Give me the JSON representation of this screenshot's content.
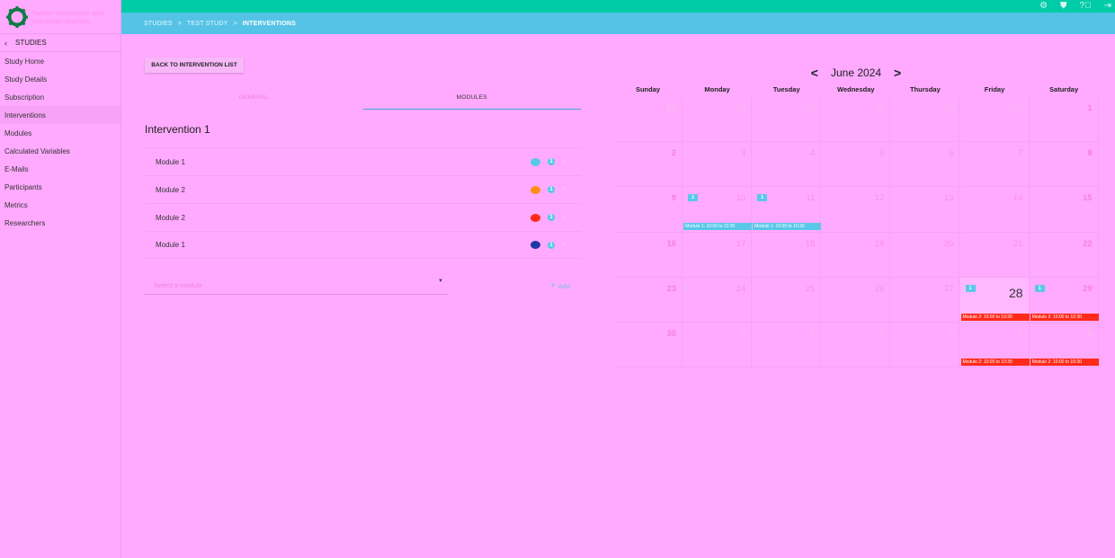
{
  "app": {
    "name": "Twente Intervention and Interaction Machine"
  },
  "sidebar": {
    "back_label": "STUDIES",
    "items": [
      {
        "label": "Study Home"
      },
      {
        "label": "Study Details"
      },
      {
        "label": "Subscription"
      },
      {
        "label": "Interventions",
        "active": true
      },
      {
        "label": "Modules"
      },
      {
        "label": "Calculated Variables"
      },
      {
        "label": "E-Mails"
      },
      {
        "label": "Participants"
      },
      {
        "label": "Metrics"
      },
      {
        "label": "Researchers"
      }
    ]
  },
  "topbar": {
    "icons": [
      "settings-icon",
      "shield-icon",
      "help-icon",
      "logout-icon"
    ]
  },
  "breadcrumb": [
    "STUDIES",
    "TEST STUDY",
    "INTERVENTIONS"
  ],
  "main": {
    "back_button": "BACK TO INTERVENTION LIST",
    "tabs": [
      {
        "label": "GENERAL"
      },
      {
        "label": "MODULES",
        "active": true
      }
    ],
    "intervention_title": "Intervention 1",
    "modules": [
      {
        "name": "Module 1",
        "color": "#58c8e8",
        "badge": "1"
      },
      {
        "name": "Module 2",
        "color": "#ff8c1a",
        "badge": "1"
      },
      {
        "name": "Module 2",
        "color": "#ff2a1a",
        "badge": "1"
      },
      {
        "name": "Module 1",
        "color": "#1f3aa8",
        "badge": "1"
      }
    ],
    "select_placeholder": "Select a module",
    "add_label": "Add"
  },
  "calendar": {
    "month_label": "June 2024",
    "weekdays": [
      "Sunday",
      "Monday",
      "Tuesday",
      "Wednesday",
      "Thursday",
      "Friday",
      "Saturday"
    ],
    "weeks": [
      [
        {
          "n": "26",
          "m": true
        },
        {
          "n": "27",
          "m": true
        },
        {
          "n": "28",
          "m": true
        },
        {
          "n": "29",
          "m": true
        },
        {
          "n": "30",
          "m": true
        },
        {
          "n": "31",
          "m": true
        },
        {
          "n": "1"
        }
      ],
      [
        {
          "n": "2"
        },
        {
          "n": "3"
        },
        {
          "n": "4"
        },
        {
          "n": "5"
        },
        {
          "n": "6"
        },
        {
          "n": "7"
        },
        {
          "n": "8"
        }
      ],
      [
        {
          "n": "9"
        },
        {
          "n": "10",
          "badge": "1"
        },
        {
          "n": "11",
          "badge": "1"
        },
        {
          "n": "12"
        },
        {
          "n": "13"
        },
        {
          "n": "14"
        },
        {
          "n": "15"
        }
      ],
      [
        {
          "n": "16"
        },
        {
          "n": "17"
        },
        {
          "n": "18"
        },
        {
          "n": "19"
        },
        {
          "n": "20"
        },
        {
          "n": "21"
        },
        {
          "n": "22"
        }
      ],
      [
        {
          "n": "23"
        },
        {
          "n": "24"
        },
        {
          "n": "25"
        },
        {
          "n": "26"
        },
        {
          "n": "27"
        },
        {
          "n": "28",
          "today": true,
          "badge": "1"
        },
        {
          "n": "29",
          "badge": "1"
        }
      ],
      [
        {
          "n": "30"
        },
        {
          "n": "1",
          "m": true
        },
        {
          "n": "2",
          "m": true
        },
        {
          "n": "3",
          "m": true
        },
        {
          "n": "4",
          "m": true
        },
        {
          "n": "5",
          "m": true
        },
        {
          "n": "6",
          "m": true
        }
      ]
    ],
    "events": [
      {
        "week": 2,
        "day": 1,
        "label": "Module 1: 10:00 to 10:30",
        "color": "blue"
      },
      {
        "week": 2,
        "day": 2,
        "label": "Module 1: 10:00 to 10:30",
        "color": "blue"
      },
      {
        "week": 4,
        "day": 5,
        "label": "Module 2: 10:00 to 10:30",
        "color": "red"
      },
      {
        "week": 4,
        "day": 6,
        "label": "Module 2: 10:00 to 10:30",
        "color": "red"
      },
      {
        "week": 5,
        "day": 5,
        "label": "Module 2: 10:00 to 10:30",
        "color": "red"
      },
      {
        "week": 5,
        "day": 6,
        "label": "Module 2: 10:00 to 10:30",
        "color": "red"
      }
    ]
  }
}
